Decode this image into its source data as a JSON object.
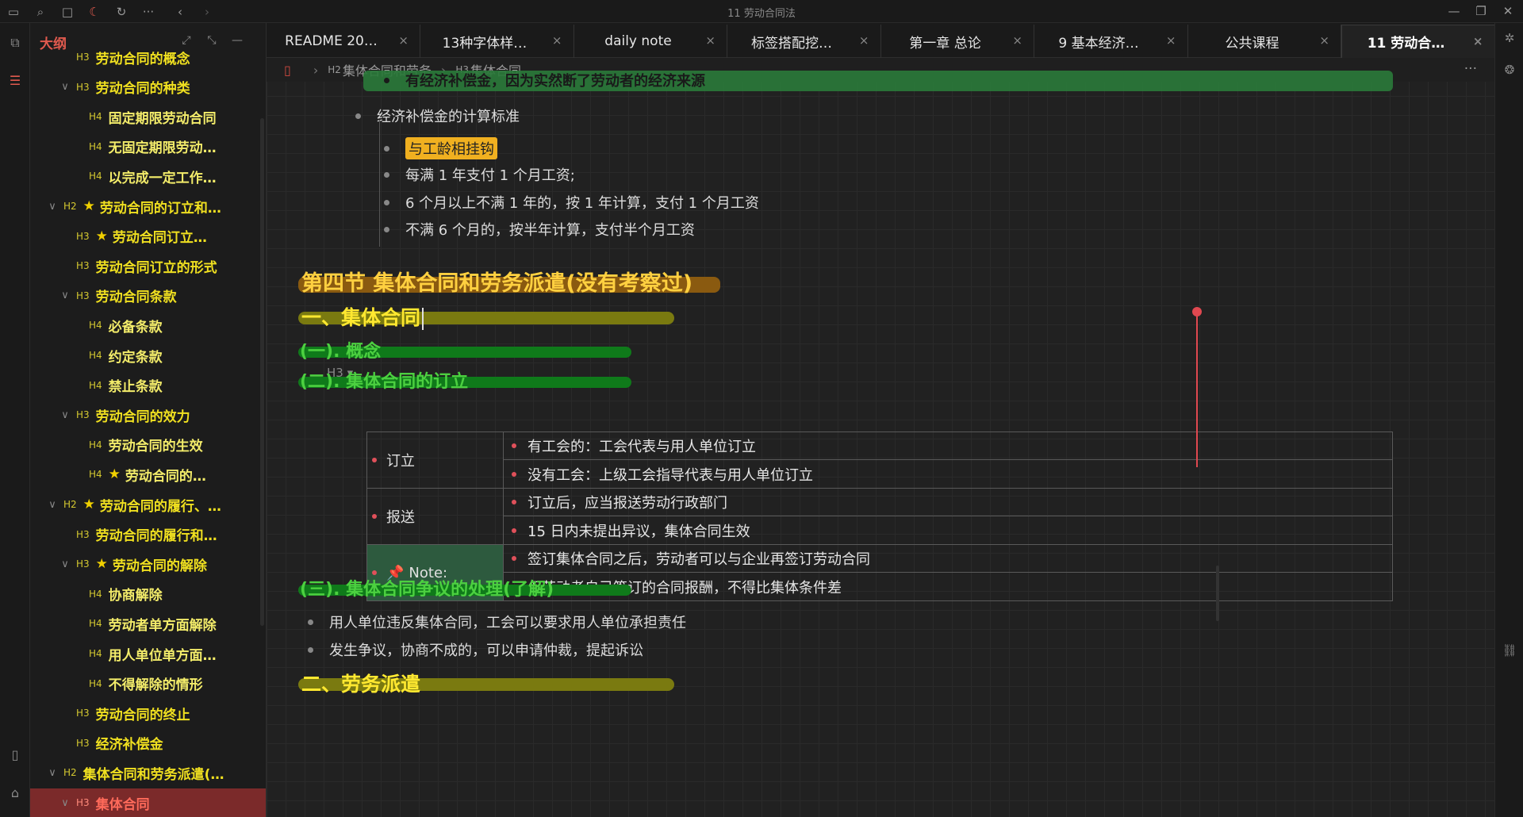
{
  "window": {
    "title": "11 劳动合同法"
  },
  "outline": {
    "title": "大纲",
    "items": [
      {
        "level": "H3",
        "text": "劳动合同的概念",
        "chev": "",
        "star": false
      },
      {
        "level": "H3",
        "text": "劳动合同的种类",
        "chev": "v",
        "star": false
      },
      {
        "level": "H4",
        "text": "固定期限劳动合同",
        "chev": "",
        "star": false
      },
      {
        "level": "H4",
        "text": "无固定期限劳动…",
        "chev": "",
        "star": false
      },
      {
        "level": "H4",
        "text": "以完成一定工作…",
        "chev": "",
        "star": false
      },
      {
        "level": "H2",
        "text": "劳动合同的订立和…",
        "chev": "v",
        "star": true
      },
      {
        "level": "H3",
        "text": "劳动合同订立…",
        "chev": "",
        "star": true
      },
      {
        "level": "H3",
        "text": "劳动合同订立的形式",
        "chev": "",
        "star": false
      },
      {
        "level": "H3",
        "text": "劳动合同条款",
        "chev": "v",
        "star": false
      },
      {
        "level": "H4",
        "text": "必备条款",
        "chev": "",
        "star": false
      },
      {
        "level": "H4",
        "text": "约定条款",
        "chev": "",
        "star": false
      },
      {
        "level": "H4",
        "text": "禁止条款",
        "chev": "",
        "star": false
      },
      {
        "level": "H3",
        "text": "劳动合同的效力",
        "chev": "v",
        "star": false
      },
      {
        "level": "H4",
        "text": "劳动合同的生效",
        "chev": "",
        "star": false
      },
      {
        "level": "H4",
        "text": "劳动合同的…",
        "chev": "",
        "star": true
      },
      {
        "level": "H2",
        "text": "劳动合同的履行、…",
        "chev": "v",
        "star": true
      },
      {
        "level": "H3",
        "text": "劳动合同的履行和…",
        "chev": "",
        "star": false
      },
      {
        "level": "H3",
        "text": "劳动合同的解除",
        "chev": "v",
        "star": true
      },
      {
        "level": "H4",
        "text": "协商解除",
        "chev": "",
        "star": false
      },
      {
        "level": "H4",
        "text": "劳动者单方面解除",
        "chev": "",
        "star": false
      },
      {
        "level": "H4",
        "text": "用人单位单方面…",
        "chev": "",
        "star": false
      },
      {
        "level": "H4",
        "text": "不得解除的情形",
        "chev": "",
        "star": false
      },
      {
        "level": "H3",
        "text": "劳动合同的终止",
        "chev": "",
        "star": false
      },
      {
        "level": "H3",
        "text": "经济补偿金",
        "chev": "",
        "star": false
      },
      {
        "level": "H2",
        "text": "集体合同和劳务派遣(…",
        "chev": "v",
        "star": false
      },
      {
        "level": "H3",
        "text": "集体合同",
        "chev": "v",
        "star": false,
        "active": true
      }
    ]
  },
  "tabs": [
    {
      "label": "README 20…"
    },
    {
      "label": "13种字体样…"
    },
    {
      "label": "daily note"
    },
    {
      "label": "标签搭配挖…"
    },
    {
      "label": "第一章 总论"
    },
    {
      "label": "9 基本经济…"
    },
    {
      "label": "公共课程"
    },
    {
      "label": "11 劳动合…",
      "active": true
    }
  ],
  "breadcrumb": {
    "level1_tag": "H2",
    "level1": "集体合同和劳务",
    "level2_tag": "H3",
    "level2": "集体合同"
  },
  "content": {
    "top_cut_text": "有经济补偿金，因为实然断了劳动者的经济来源",
    "bullet_std": "经济补偿金的计算标准",
    "sub_mark": "与工龄相挂钩",
    "sub1": "每满 1 年支付 1 个月工资;",
    "sub2": "6 个月以上不满 1 年的，按 1 年计算，支付 1 个月工资",
    "sub3": "不满 6 个月的，按半年计算，支付半个月工资",
    "h2": "第四节  集体合同和劳务派遣(没有考察过)",
    "h3_tag": "H3",
    "h3a": "一、集体合同",
    "h4a": "(一). 概念",
    "h4b": "(二). 集体合同的订立",
    "table": {
      "rows": [
        {
          "label": "订立",
          "items": [
            "有工会的：工会代表与用人单位订立",
            "没有工会：上级工会指导代表与用人单位订立"
          ]
        },
        {
          "label": "报送",
          "items": [
            "订立后，应当报送劳动行政部门",
            "15 日内未提出异议，集体合同生效"
          ]
        },
        {
          "label": "Note:",
          "icon": "📌",
          "items": [
            "签订集体合同之后，劳动者可以与企业再签订劳动合同",
            "但劳动者自己签订的合同报酬，不得比集体条件差"
          ]
        }
      ]
    },
    "h4c": "(三). 集体合同争议的处理(了解)",
    "b1": "用人单位违反集体合同，工会可以要求用人单位承担责任",
    "b2": "发生争议，协商不成的，可以申请仲裁，提起诉讼",
    "h3b": "二、劳务派遣"
  },
  "colors": {
    "accent_red": "#e05a4e",
    "heading_yellow": "#ffe830",
    "heading_green": "#4cd040",
    "note_bg": "#2d5a3e"
  }
}
